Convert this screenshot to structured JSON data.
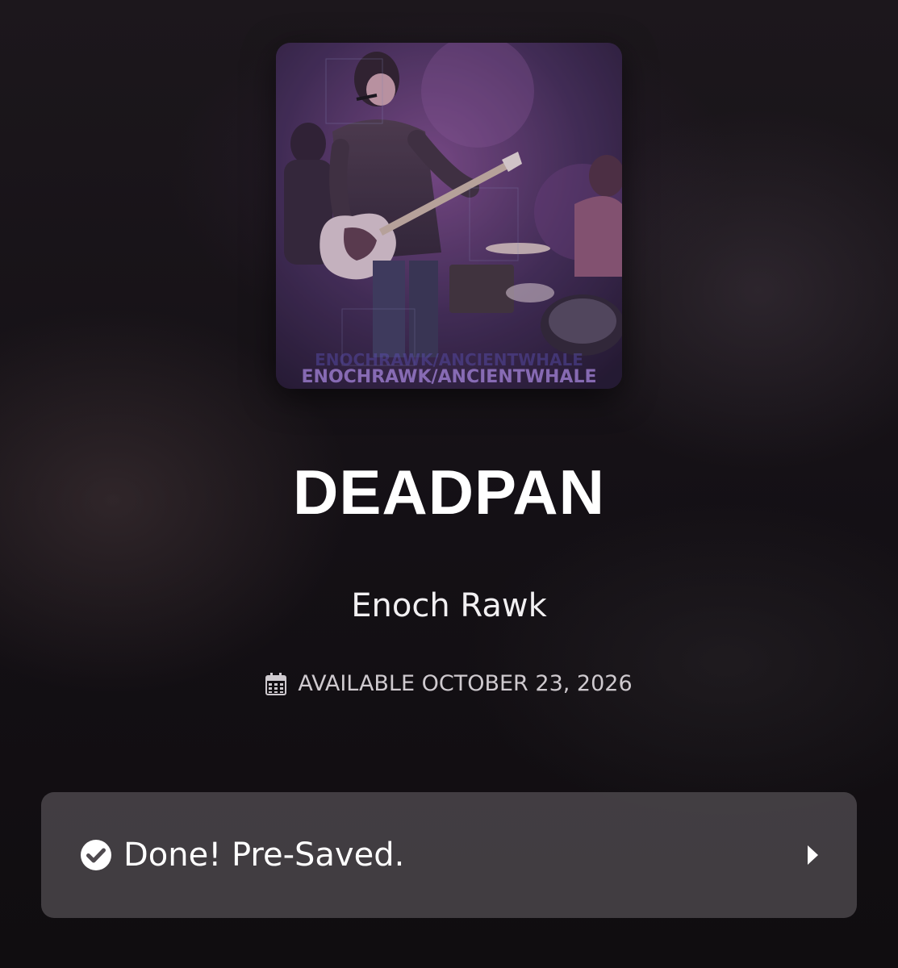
{
  "release": {
    "title": "DEADPAN",
    "artist": "Enoch Rawk",
    "availability": "AVAILABLE OCTOBER 23, 2026",
    "artwork_caption": "ENOCHRAWK/ANCIENTWHALE"
  },
  "presave": {
    "status_label": "Done! Pre-Saved."
  },
  "icons": {
    "calendar": "calendar-icon",
    "check": "check-circle-icon",
    "chevron": "chevron-right-icon"
  },
  "colors": {
    "background": "#17121a",
    "card": "#555055",
    "text": "#ffffff",
    "muted": "#cfcacf"
  }
}
